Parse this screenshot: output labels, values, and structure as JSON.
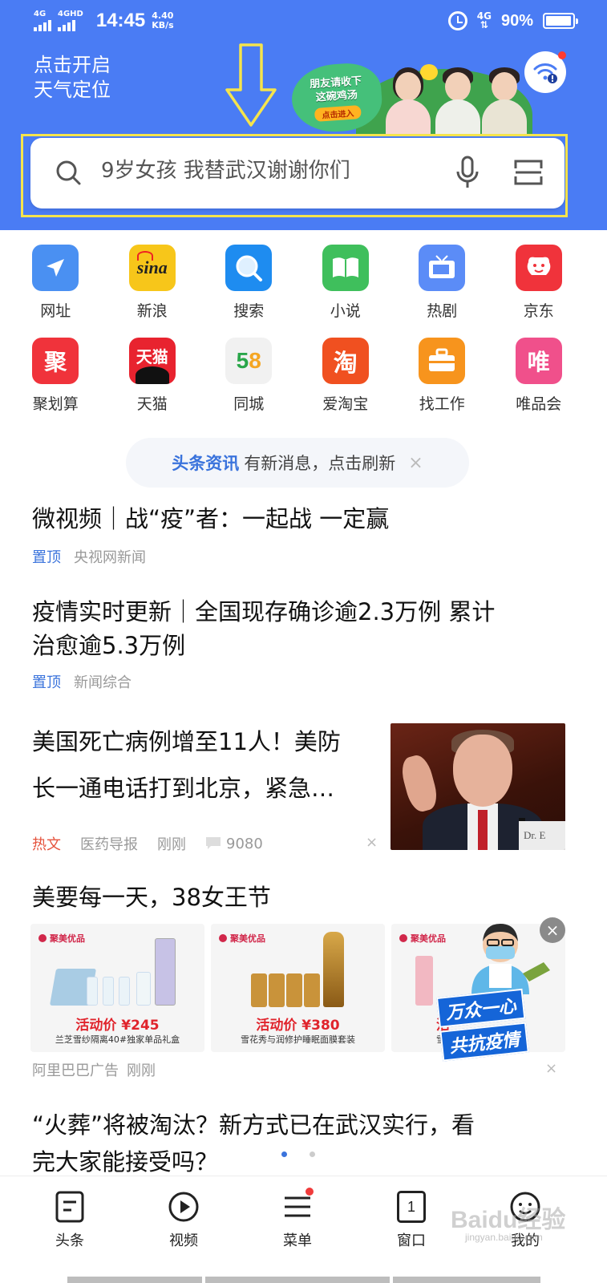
{
  "status_bar": {
    "signal1_label": "4G",
    "signal2_label": "4GHD",
    "time": "14:45",
    "speed_value": "4.40",
    "speed_unit": "KB/s",
    "net_label": "4G",
    "battery": "90%"
  },
  "header": {
    "weather_line1": "点击开启",
    "weather_line2": "天气定位",
    "promo_line1": "朋友请收下",
    "promo_line2": "这碗鸡汤",
    "promo_button": "点击进入"
  },
  "search": {
    "placeholder": "9岁女孩 我替武汉谢谢你们"
  },
  "apps": [
    [
      {
        "label": "网址",
        "icon": "navigation-arrow-icon",
        "color": "#4a90f2"
      },
      {
        "label": "新浪",
        "icon": "sina-logo-icon",
        "color": "#f7c61a"
      },
      {
        "label": "搜索",
        "icon": "magnifier-icon",
        "color": "#1e8cf0"
      },
      {
        "label": "小说",
        "icon": "open-book-icon",
        "color": "#3fbf5c"
      },
      {
        "label": "热剧",
        "icon": "tv-icon",
        "color": "#5b8cf7"
      },
      {
        "label": "京东",
        "icon": "jd-dog-icon",
        "color": "#f0333b"
      }
    ],
    [
      {
        "label": "聚划算",
        "icon": "ju-icon",
        "glyph": "聚",
        "color": "#f0333b"
      },
      {
        "label": "天猫",
        "icon": "tmall-icon",
        "glyph": "天猫",
        "color": "#e8232f"
      },
      {
        "label": "同城",
        "icon": "58-icon",
        "glyph": "58",
        "color": "#f1f1f1"
      },
      {
        "label": "爱淘宝",
        "icon": "taobao-icon",
        "glyph": "淘",
        "color": "#f05020"
      },
      {
        "label": "找工作",
        "icon": "briefcase-icon",
        "color": "#f7941d"
      },
      {
        "label": "唯品会",
        "icon": "vip-icon",
        "glyph": "唯",
        "color": "#f0508b"
      }
    ]
  ],
  "notice": {
    "tag": "头条资讯",
    "text": "有新消息，点击刷新",
    "close": "×"
  },
  "feed": {
    "item1_title": "微视频｜战“疫”者：一起战 一定赢",
    "item1_tag": "置顶",
    "item1_source": "央视网新闻",
    "item2_title_line1": "疫情实时更新｜全国现存确诊逾2.3万例 累计",
    "item2_title_line2": "治愈逾5.3万例",
    "item2_tag": "置顶",
    "item2_source": "新闻综合",
    "item3_title_line1": "美国死亡病例增至11人！美防",
    "item3_title_line2": "长一通电话打到北京，紧急…",
    "item3_tag": "热文",
    "item3_source": "医药导报",
    "item3_time": "刚刚",
    "item3_comments": "9080",
    "item3_photo_sign": "Dr. E",
    "close_mark": "×",
    "item4_title": "美要每一天，38女王节",
    "ads": [
      {
        "brand": "聚美优品",
        "price": "活动价 ¥245",
        "desc": "兰芝雪纱隔离40#独家单品礼盒"
      },
      {
        "brand": "聚美优品",
        "price": "活动价 ¥380",
        "desc": "雪花秀与润修护睡眠面膜套装"
      },
      {
        "brand": "聚美优品",
        "price": "活",
        "desc": "雪"
      }
    ],
    "ad_close": "×",
    "campaign_line1": "万众一心",
    "campaign_line2": "共抗疫情",
    "ad_source": "阿里巴巴广告",
    "ad_time": "刚刚",
    "item5_title_line1": "“火葬”将被淘汰？新方式已在武汉实行，看",
    "item5_title_line2": "完大家能接受吗？"
  },
  "bottom_nav": {
    "items": [
      {
        "label": "头条",
        "icon": "headline-icon"
      },
      {
        "label": "视频",
        "icon": "play-icon"
      },
      {
        "label": "菜单",
        "icon": "menu-icon"
      },
      {
        "label": "窗口",
        "icon": "window-icon",
        "count": "1"
      },
      {
        "label": "我的",
        "icon": "profile-icon"
      }
    ]
  },
  "watermark": {
    "text": "Baidu经验",
    "sub": "jingyan.baidu.com"
  }
}
